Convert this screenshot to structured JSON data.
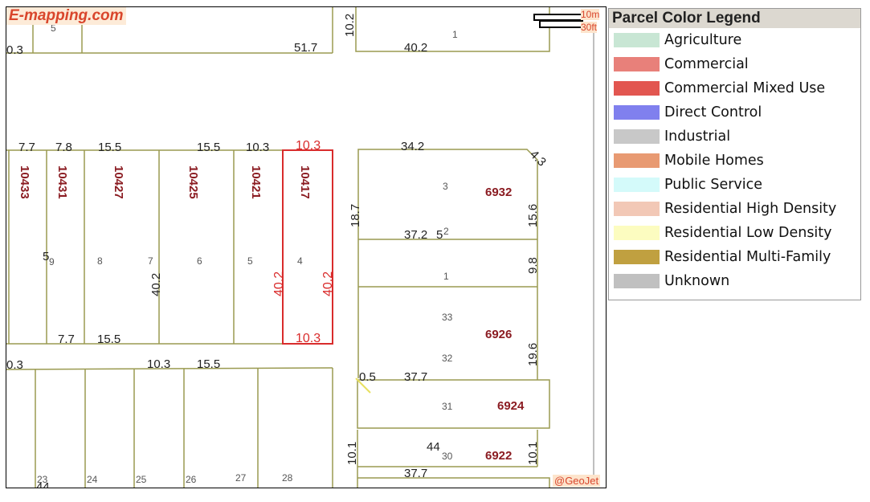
{
  "map": {
    "brand": "E-mapping.com",
    "attribution": "@GeoJet",
    "scale": {
      "metric": "10m",
      "imperial": "30ft"
    },
    "dimensions": [
      "0.3",
      "51.7",
      "10.2",
      "40.2",
      "7.7",
      "7.8",
      "15.5",
      "15.5",
      "10.3",
      "10.3",
      "34.2",
      "4.3",
      "18.7",
      "15.6",
      "37.2",
      "9.8",
      "40.2",
      "40.2",
      "40.2",
      "7.7",
      "15.5",
      "10.3",
      "19.6",
      "0.3",
      "10.3",
      "15.5",
      "0.5",
      "37.7",
      "44",
      "10.1",
      "10.1",
      "37.7",
      "5",
      "5",
      "44"
    ],
    "lot_numbers": [
      "1",
      "3",
      "2",
      "1",
      "33",
      "32",
      "31",
      "30",
      "9",
      "8",
      "7",
      "6",
      "5",
      "4",
      "23",
      "24",
      "25",
      "26",
      "27",
      "28",
      "5"
    ],
    "addresses": [
      "10433",
      "10431",
      "10427",
      "10425",
      "10421",
      "10417",
      "6932",
      "6926",
      "6924",
      "6922"
    ],
    "selected_parcel": "10417",
    "selected_color": "#d92c2c"
  },
  "legend": {
    "title": "Parcel Color Legend",
    "items": [
      {
        "label": "Agriculture",
        "color": "#c8e6d4"
      },
      {
        "label": "Commercial",
        "color": "#e8807a"
      },
      {
        "label": "Commercial Mixed Use",
        "color": "#e25650"
      },
      {
        "label": "Direct Control",
        "color": "#8080ee"
      },
      {
        "label": "Industrial",
        "color": "#c8c8c8"
      },
      {
        "label": "Mobile Homes",
        "color": "#e89a72"
      },
      {
        "label": "Public Service",
        "color": "#d4fafa"
      },
      {
        "label": "Residential High Density",
        "color": "#f2c8b6"
      },
      {
        "label": "Residential Low Density",
        "color": "#fcfcc0"
      },
      {
        "label": "Residential Multi-Family",
        "color": "#c0a040"
      },
      {
        "label": "Unknown",
        "color": "#c0c0c0"
      }
    ]
  }
}
